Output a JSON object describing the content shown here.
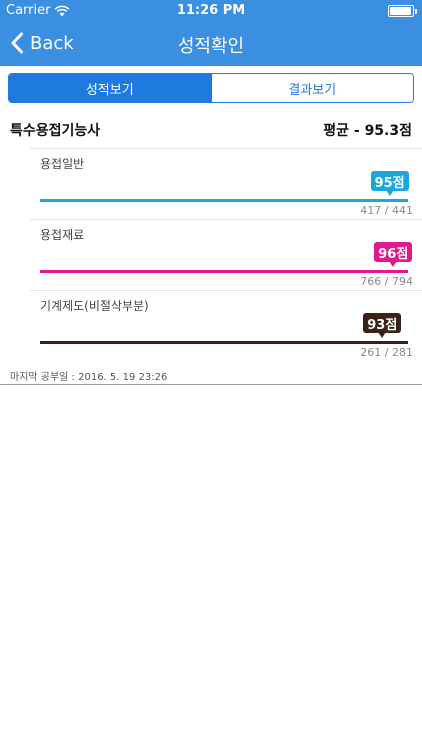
{
  "status_bar": {
    "carrier": "Carrier",
    "time": "11:26 PM"
  },
  "nav": {
    "back_label": "Back",
    "title": "성적확인"
  },
  "tabs": [
    {
      "label": "성적보기",
      "active": true
    },
    {
      "label": "결과보기",
      "active": false
    }
  ],
  "exam": {
    "name": "특수용접기능사",
    "average_label": "평균 - 95.3점"
  },
  "subjects": [
    {
      "label": "용접일반",
      "score_label": "95점",
      "score": 95,
      "count": "417 / 441",
      "color": "#1aa7e0"
    },
    {
      "label": "용접재료",
      "score_label": "96점",
      "score": 96,
      "count": "766 / 794",
      "color": "#e0198f"
    },
    {
      "label": "기계제도(비절삭부분)",
      "score_label": "93점",
      "score": 93,
      "count": "261 / 281",
      "color": "#3b2217"
    }
  ],
  "last_study": "마지막 공부일 : 2016. 5. 19 23:26"
}
